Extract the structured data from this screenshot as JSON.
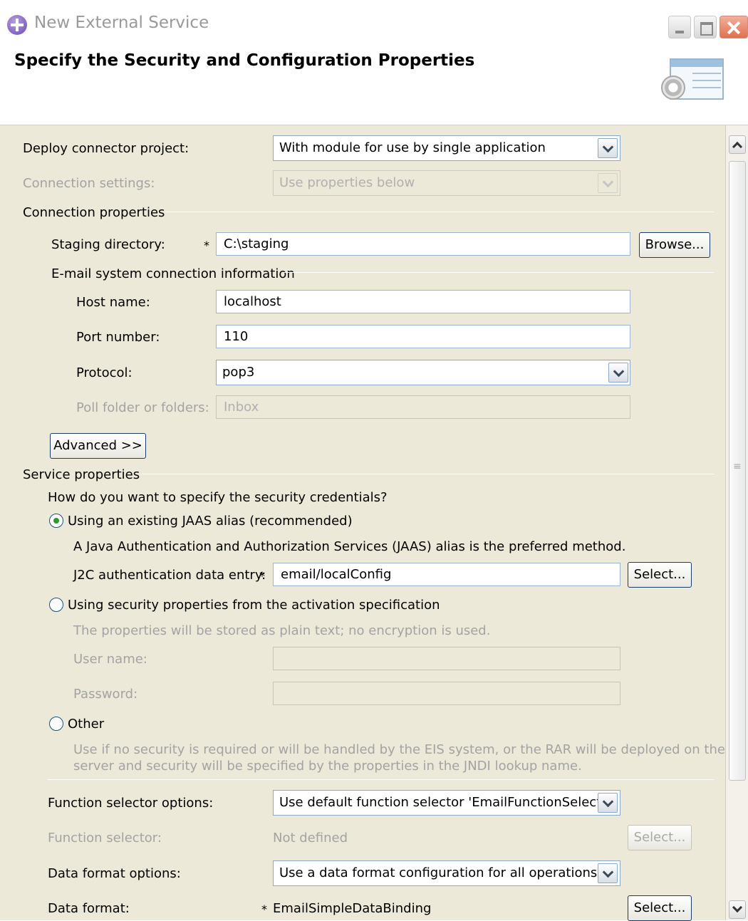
{
  "window": {
    "title": "New External Service",
    "header_title": "Specify the Security and Configuration Properties"
  },
  "deploy": {
    "label": "Deploy connector project:",
    "value": "With module for use by single application"
  },
  "connection_settings": {
    "label": "Connection settings:",
    "value": "Use properties below"
  },
  "connection_properties": {
    "section_label": "Connection properties",
    "staging_label": "Staging directory:",
    "staging_value": "C:\\staging",
    "browse_label": "Browse...",
    "required_mark": "*"
  },
  "email": {
    "section_label": "E-mail system connection information",
    "host_label": "Host name:",
    "host_value": "localhost",
    "port_label": "Port number:",
    "port_value": "110",
    "protocol_label": "Protocol:",
    "protocol_value": "pop3",
    "poll_label": "Poll folder or folders:",
    "poll_value": "Inbox",
    "advanced_label": "Advanced >>"
  },
  "service": {
    "section_label": "Service properties",
    "question": "How do you want to specify the security credentials?",
    "option_jaas": "Using an existing JAAS alias (recommended)",
    "jaas_desc": "A Java Authentication and Authorization Services (JAAS) alias is the preferred method.",
    "j2c_label": "J2C authentication data entry:",
    "j2c_value": "email/localConfig",
    "select_label": "Select...",
    "option_activation": "Using security properties from the activation specification",
    "activation_desc": "The properties will be stored as plain text; no encryption is used.",
    "user_label": "User name:",
    "password_label": "Password:",
    "option_other": "Other",
    "other_desc_line1": "Use if no security is required or will be handled by the EIS system, or the RAR will be deployed on the",
    "other_desc_line2": "server and security will be specified by the properties in the JNDI lookup name.",
    "selected_option": "jaas"
  },
  "function": {
    "options_label": "Function selector options:",
    "options_value": "Use default function selector 'EmailFunctionSelector'",
    "selector_label": "Function selector:",
    "selector_value": "Not defined",
    "select_label": "Select..."
  },
  "data_format": {
    "options_label": "Data format options:",
    "options_value": "Use a data format configuration for all operations",
    "format_label": "Data format:",
    "format_value": "EmailSimpleDataBinding",
    "select_label": "Select..."
  }
}
